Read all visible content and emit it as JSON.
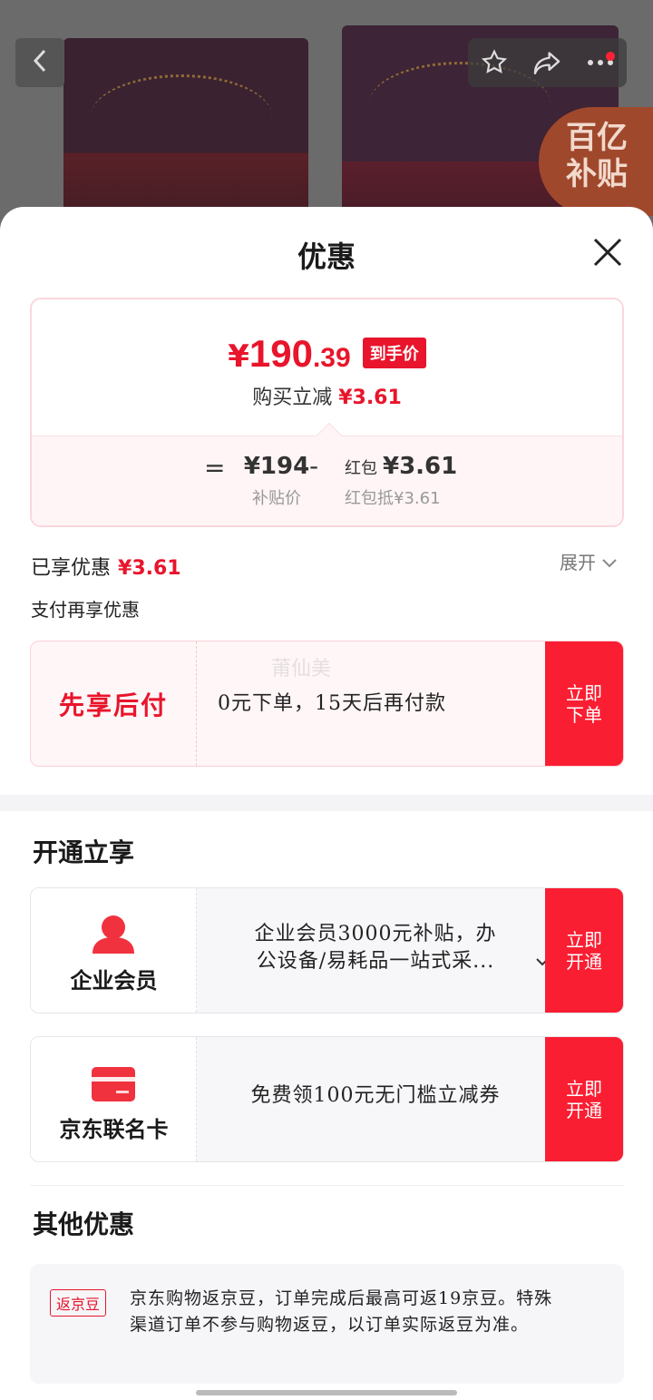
{
  "header": {
    "back_icon": "chevron-left-icon",
    "actions": [
      "star-icon",
      "share-icon",
      "more-icon"
    ],
    "subsidy_badge": "百亿\n补贴"
  },
  "sheet": {
    "title": "优惠",
    "close_icon": "close-icon"
  },
  "price_card": {
    "currency": "¥",
    "price_int": "190",
    "price_dec": ".39",
    "price_tag": "到手价",
    "discount_label": "购买立减",
    "discount_value": "¥3.61",
    "eq": "=",
    "base_value": "¥194",
    "base_label": "补贴价",
    "minus": "-",
    "redpack_prefix": "红包",
    "redpack_value": "¥3.61",
    "redpack_label": "红包抵¥3.61"
  },
  "enjoyed": {
    "label": "已享优惠",
    "value": "¥3.61",
    "expand_label": "展开"
  },
  "pay_more": "支付再享优惠",
  "pay_later": {
    "title": "先享后付",
    "desc": "0元下单，15天后再付款",
    "watermark": "莆仙美",
    "cta": "立即\n下单"
  },
  "open_section": {
    "title": "开通立享",
    "cards": [
      {
        "icon": "user-icon",
        "label": "企业会员",
        "desc_line1": "企业会员3000元补贴，办",
        "desc_line2": "公设备/易耗品一站式采...",
        "cta": "立即\n开通"
      },
      {
        "icon": "credit-card-icon",
        "label": "京东联名卡",
        "desc_line1": "免费领100元无门槛立减券",
        "cta": "立即\n开通"
      }
    ]
  },
  "other_section": {
    "title": "其他优惠",
    "tag": "返京豆",
    "text": "京东购物返京豆，订单完成后最高可返19京豆。特殊渠道订单不参与购物返豆，以订单实际返豆为准。"
  },
  "colors": {
    "accent": "#e8152c",
    "cta_bg": "#fa1e32",
    "card_pink": "#fff5f6"
  }
}
